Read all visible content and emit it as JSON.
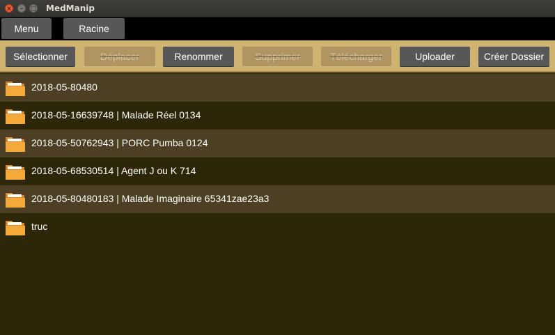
{
  "window": {
    "title": "MedManip",
    "close_glyph": "×",
    "min_glyph": "–",
    "max_glyph": "□"
  },
  "navbar": {
    "menu_label": "Menu",
    "root_label": "Racine"
  },
  "toolbar": {
    "select_label": "Sélectionner",
    "move_label": "Déplacer",
    "rename_label": "Renommer",
    "delete_label": "Supprimer",
    "download_label": "Télécharger",
    "upload_label": "Uploader",
    "create_folder_label": "Créer Dossier",
    "disabled_buttons": [
      "Déplacer",
      "Supprimer",
      "Télécharger"
    ]
  },
  "files": [
    {
      "name": "2018-05-80480",
      "icon": "folder-icon"
    },
    {
      "name": "2018-05-16639748 | Malade Réel 0134",
      "icon": "folder-icon"
    },
    {
      "name": "2018-05-50762943 | PORC Pumba 0124",
      "icon": "folder-icon"
    },
    {
      "name": "2018-05-68530514 | Agent J ou K 714",
      "icon": "folder-icon"
    },
    {
      "name": "2018-05-80480183 | Malade Imaginaire 65341zae23a3",
      "icon": "folder-icon"
    },
    {
      "name": "truc",
      "icon": "folder-icon"
    }
  ],
  "colors": {
    "background": "#2e2608",
    "row_alt": "#4c3f23",
    "toolbar": "#ceb371",
    "button": "#575757",
    "folder": "#f5a93a"
  }
}
